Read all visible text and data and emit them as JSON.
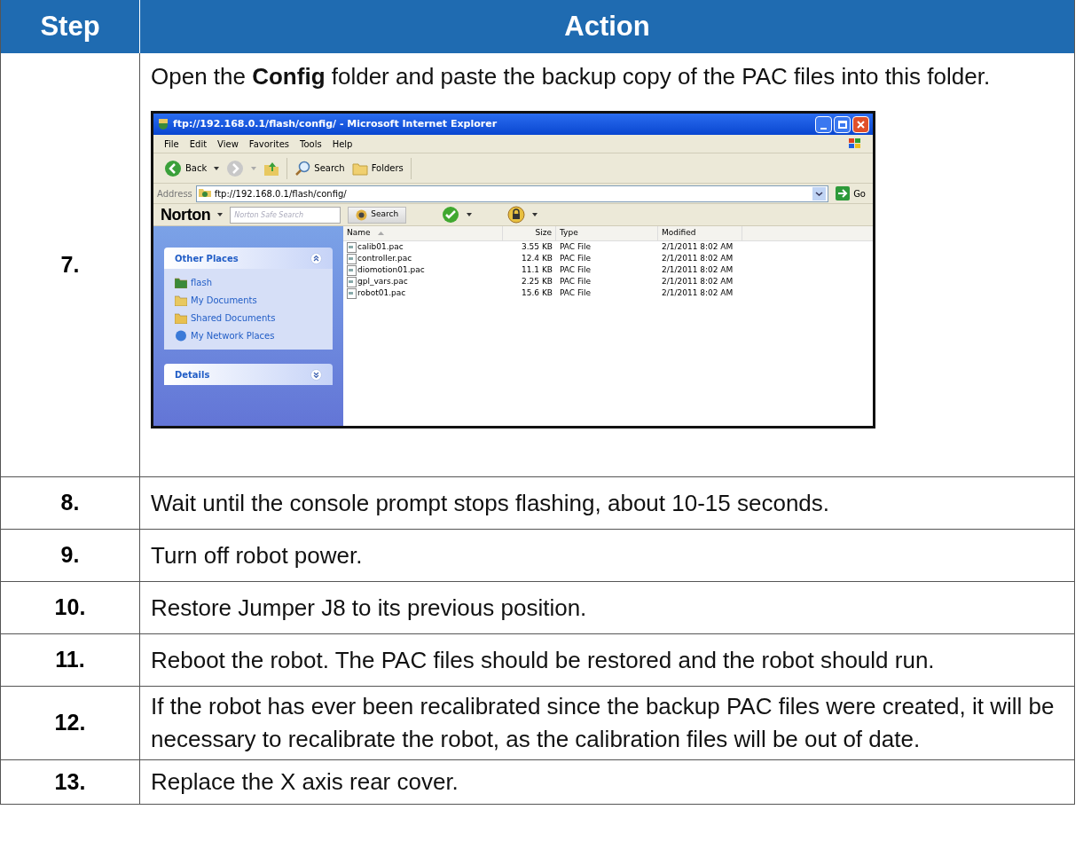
{
  "header": {
    "step": "Step",
    "action": "Action"
  },
  "rows": [
    {
      "step": "7.",
      "text": "Open the **Config** folder and paste the backup copy of the PAC files into this folder.",
      "screenshot": {
        "title": "ftp://192.168.0.1/flash/config/ - Microsoft Internet Explorer",
        "menu": [
          "File",
          "Edit",
          "View",
          "Favorites",
          "Tools",
          "Help"
        ],
        "toolbar": {
          "back": "Back",
          "search": "Search",
          "folders": "Folders"
        },
        "address": {
          "label": "Address",
          "value": "ftp://192.168.0.1/flash/config/",
          "go": "Go"
        },
        "norton": {
          "brand": "Norton",
          "placeholder": "Norton Safe Search",
          "search": "Search"
        },
        "panels": [
          {
            "title": "Other Places",
            "expanded": true,
            "items": [
              "flash",
              "My Documents",
              "Shared Documents",
              "My Network Places"
            ]
          },
          {
            "title": "Details",
            "expanded": false
          }
        ],
        "columns": [
          "Name",
          "Size",
          "Type",
          "Modified"
        ],
        "files": [
          [
            "calib01.pac",
            "3.55 KB",
            "PAC File",
            "2/1/2011 8:02 AM"
          ],
          [
            "controller.pac",
            "12.4 KB",
            "PAC File",
            "2/1/2011 8:02 AM"
          ],
          [
            "diomotion01.pac",
            "11.1 KB",
            "PAC File",
            "2/1/2011 8:02 AM"
          ],
          [
            "gpl_vars.pac",
            "2.25 KB",
            "PAC File",
            "2/1/2011 8:02 AM"
          ],
          [
            "robot01.pac",
            "15.6 KB",
            "PAC File",
            "2/1/2011 8:02 AM"
          ]
        ]
      }
    },
    {
      "step": "8.",
      "text": "Wait until the console prompt stops flashing, about 10-15 seconds."
    },
    {
      "step": "9.",
      "text": "Turn off robot power."
    },
    {
      "step": "10.",
      "text": "Restore Jumper J8 to its previous position."
    },
    {
      "step": "11.",
      "text": "Reboot the robot. The PAC files should be restored and the robot should run."
    },
    {
      "step": "12.",
      "text": "If the robot has ever been recalibrated since the backup PAC files were created, it will be necessary to recalibrate the robot, as the calibration files will be out of date."
    },
    {
      "step": "13.",
      "text": "Replace the X axis rear cover."
    }
  ]
}
